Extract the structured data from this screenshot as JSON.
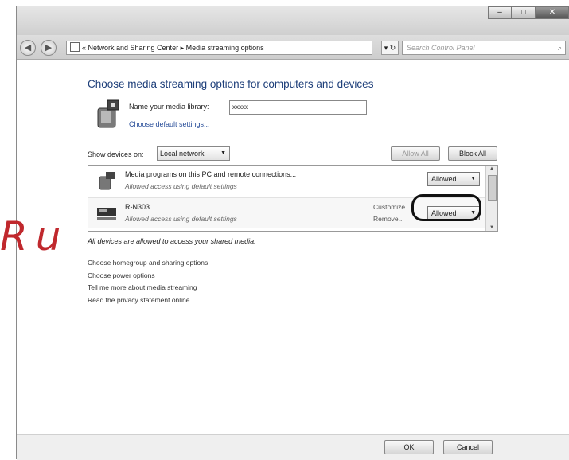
{
  "window": {
    "caption_buttons": [
      "minimize-icon",
      "maximize-icon",
      "close-icon"
    ]
  },
  "navbar": {
    "back_icon": "back-arrow-icon",
    "forward_icon": "forward-arrow-icon",
    "breadcrumb": "« Network and Sharing Center ▸ Media streaming options",
    "refresh_glyph": "▾ ↻",
    "search_placeholder": "Search Control Panel",
    "search_icon": "search-icon"
  },
  "main": {
    "heading": "Choose media streaming options for computers and devices",
    "library_label": "Name your media library:",
    "library_value": "xxxxx",
    "default_settings_link": "Choose default settings...",
    "show_devices_label": "Show devices on:",
    "show_devices_value": "Local network",
    "allow_all": "Allow All",
    "block_all": "Block All",
    "devices": [
      {
        "name": "Media programs on this PC and remote connections...",
        "subtitle": "Allowed access using default settings",
        "permission": "Allowed"
      },
      {
        "name": "R-N303",
        "subtitle": "Allowed access using default settings",
        "customize_link": "Customize...",
        "remove_link": "Remove...",
        "permission": "Allowed"
      }
    ],
    "all_allowed_text": "All devices are allowed to access your shared media.",
    "links": [
      "Choose homegroup and sharing options",
      "Choose power options",
      "Tell me more about media streaming",
      "Read the privacy statement online"
    ]
  },
  "footer": {
    "ok": "OK",
    "cancel": "Cancel"
  },
  "overlay": {
    "label": "Ru"
  }
}
